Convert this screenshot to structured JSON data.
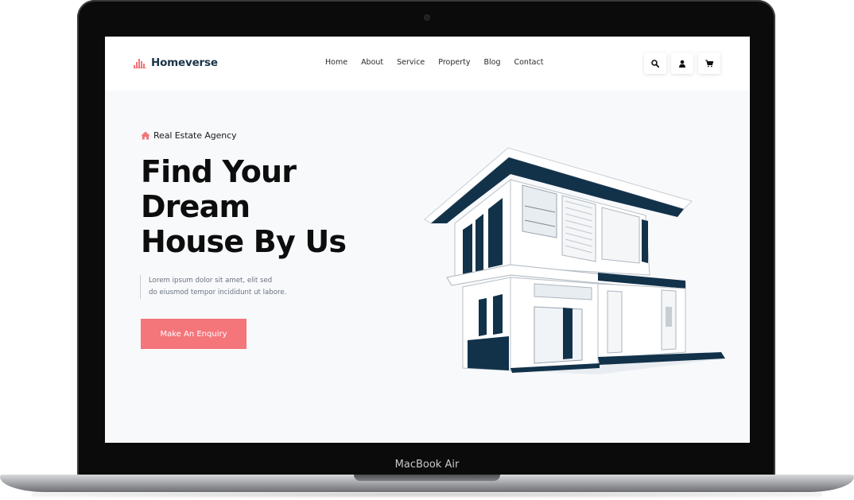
{
  "brand": {
    "name": "Homeverse"
  },
  "nav": {
    "links": [
      "Home",
      "About",
      "Service",
      "Property",
      "Blog",
      "Contact"
    ]
  },
  "actions": {
    "icons": [
      "search-icon",
      "user-icon",
      "cart-icon"
    ]
  },
  "hero": {
    "eyebrow": "Real Estate Agency",
    "title_lines": [
      "Find Your",
      "Dream",
      "House By Us"
    ],
    "text_lines": [
      "Lorem ipsum dolor sit amet, elit sed",
      "do eiusmod tempor incididunt ut labore."
    ],
    "cta": "Make An Enquiry"
  },
  "device": {
    "label": "MacBook Air"
  },
  "colors": {
    "accent": "#f4757a",
    "brand_dark": "#1a3448",
    "hero_bg": "#f7f9fb"
  }
}
